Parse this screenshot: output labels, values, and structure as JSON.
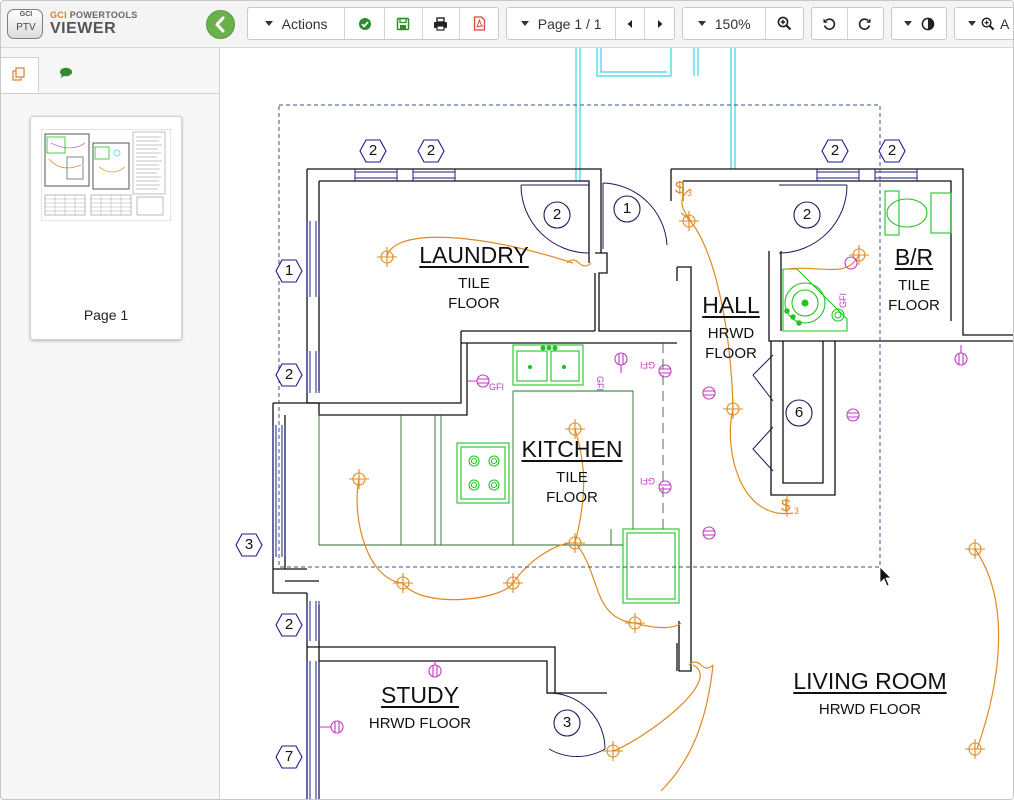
{
  "app": {
    "logo_badge_top": "GCI",
    "logo_badge_bottom": "PTV",
    "brand_prefix": "GCI",
    "brand_suffix": "POWERTOOLS",
    "product": "VIEWER"
  },
  "toolbar": {
    "actions_label": "Actions",
    "page_label": "Page 1 / 1",
    "zoom_label": "150%",
    "last_group_text": "A"
  },
  "sidebar": {
    "thumbnail_label": "Page 1"
  },
  "drawing": {
    "rooms": {
      "laundry": {
        "name": "LAUNDRY",
        "floor1": "TILE",
        "floor2": "FLOOR"
      },
      "kitchen": {
        "name": "KITCHEN",
        "floor1": "TILE",
        "floor2": "FLOOR"
      },
      "hall": {
        "name": "HALL",
        "floor1": "HRWD",
        "floor2": "FLOOR"
      },
      "br": {
        "name": "B/R",
        "floor1": "TILE",
        "floor2": "FLOOR"
      },
      "study": {
        "name": "STUDY",
        "floor1": "HRWD FLOOR"
      },
      "living": {
        "name": "LIVING ROOM",
        "floor1": "HRWD FLOOR"
      }
    },
    "door_tags": [
      "2",
      "1",
      "2",
      "6",
      "3"
    ],
    "window_tags": [
      "2",
      "2",
      "2",
      "2",
      "1",
      "2",
      "3",
      "2",
      "7"
    ],
    "gfi": [
      "GFI",
      "GFI",
      "GFI",
      "GFI",
      "GFI"
    ],
    "switch": [
      "$",
      "3",
      "$",
      "3"
    ]
  },
  "colors": {
    "accent_green": "#6ab04c",
    "wall": "#111111",
    "wire": "#e08a1e",
    "outlet": "#c437c4",
    "fixture": "#22c422",
    "cyan": "#36d6e6",
    "tag": "#1a1a8c",
    "pdf_red": "#d9463b"
  }
}
